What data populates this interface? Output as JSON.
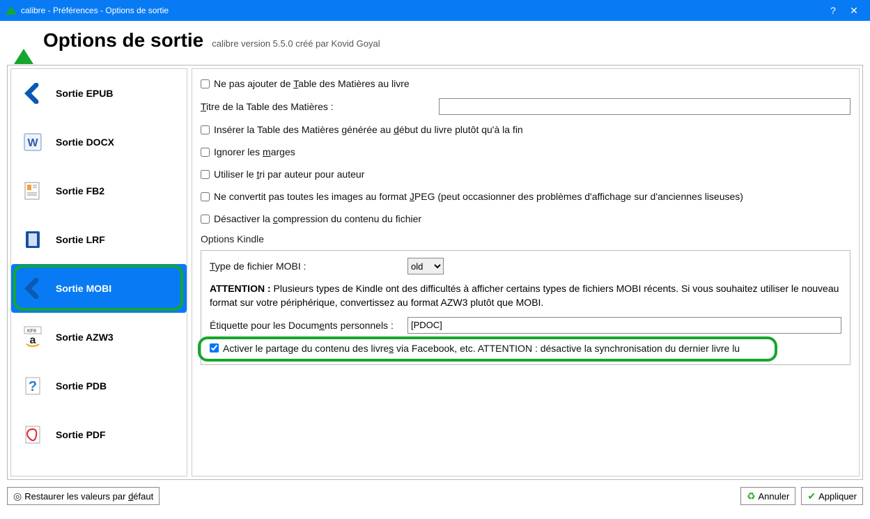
{
  "titlebar": {
    "title": "calibre - Préférences - Options de sortie"
  },
  "header": {
    "title": "Options de sortie",
    "version": "calibre version 5.5.0 créé par Kovid Goyal"
  },
  "sidebar": {
    "items": [
      {
        "label": "Sortie EPUB"
      },
      {
        "label": "Sortie DOCX"
      },
      {
        "label": "Sortie FB2"
      },
      {
        "label": "Sortie LRF"
      },
      {
        "label": "Sortie MOBI"
      },
      {
        "label": "Sortie AZW3"
      },
      {
        "label": "Sortie PDB"
      },
      {
        "label": "Sortie PDF"
      }
    ],
    "selected_index": 4
  },
  "options": {
    "no_toc": "Ne pas ajouter de Table des Matières au livre",
    "toc_title_label": "Titre de la Table des Matières :",
    "toc_title_value": "",
    "toc_start": "Insérer la Table des Matières générée au début du livre plutôt qu'à la fin",
    "ignore_margins": "Ignorer les marges",
    "author_sort": "Utiliser le tri par auteur pour auteur",
    "no_jpeg": "Ne convertit pas toutes les images au format JPEG (peut occasionner des problèmes d'affichage sur d'anciennes liseuses)",
    "no_compress": "Désactiver la compression du contenu du fichier",
    "kindle_section": "Options Kindle",
    "mobi_type_label": "Type de fichier MOBI :",
    "mobi_type_value": "old",
    "attention_label": "ATTENTION :",
    "attention_text": "Plusieurs types de Kindle ont des difficultés à afficher certains types de fichiers MOBI récents. Si vous souhaitez utiliser le nouveau format sur votre périphérique, convertissez au format AZW3 plutôt que MOBI.",
    "pdoc_label": "Étiquette pour les Documents personnels :",
    "pdoc_value": "[PDOC]",
    "share_label": "Activer le partage du contenu des livres via Facebook, etc. ATTENTION : désactive la synchronisation du dernier livre lu",
    "share_checked": true
  },
  "footer": {
    "restore": "Restaurer les valeurs par défaut",
    "cancel": "Annuler",
    "apply": "Appliquer"
  }
}
